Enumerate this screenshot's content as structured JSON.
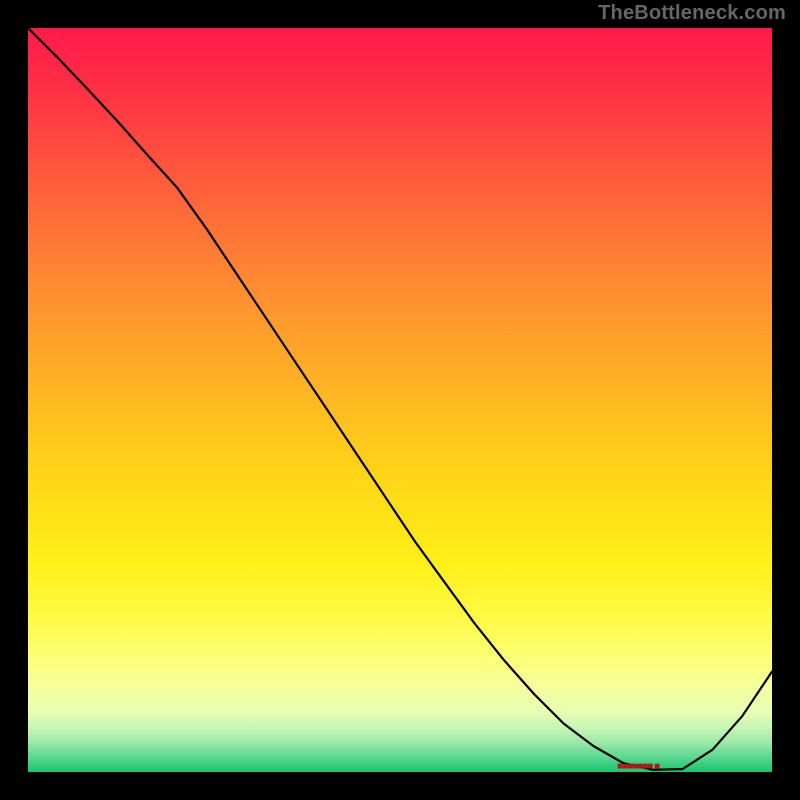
{
  "attribution": "TheBottleneck.com",
  "chart_data": {
    "type": "line",
    "title": "",
    "xlabel": "",
    "ylabel": "",
    "x": [
      0.0,
      0.04,
      0.08,
      0.12,
      0.16,
      0.2,
      0.24,
      0.28,
      0.32,
      0.36,
      0.4,
      0.44,
      0.48,
      0.52,
      0.56,
      0.6,
      0.64,
      0.68,
      0.72,
      0.76,
      0.8,
      0.84,
      0.88,
      0.92,
      0.96,
      1.0
    ],
    "values": [
      1.0,
      0.96,
      0.918,
      0.875,
      0.83,
      0.786,
      0.73,
      0.67,
      0.61,
      0.55,
      0.49,
      0.43,
      0.37,
      0.31,
      0.255,
      0.2,
      0.15,
      0.105,
      0.065,
      0.035,
      0.012,
      0.003,
      0.004,
      0.03,
      0.075,
      0.135
    ],
    "xlim": [
      0,
      1
    ],
    "ylim": [
      0,
      1
    ],
    "marker_x": 0.82,
    "marker_label": "■■■■■■■ ■",
    "gradient_stops": [
      {
        "pos": 0.0,
        "color": "#ff1a4b"
      },
      {
        "pos": 0.5,
        "color": "#ffd517"
      },
      {
        "pos": 0.85,
        "color": "#fcff7a"
      },
      {
        "pos": 1.0,
        "color": "#18c56e"
      }
    ]
  }
}
